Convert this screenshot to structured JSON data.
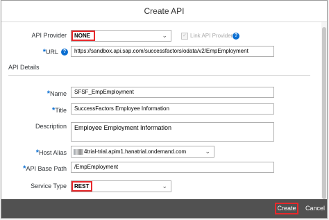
{
  "dialog": {
    "title": "Create API"
  },
  "fields": {
    "api_provider": {
      "label": "API Provider",
      "value": "NONE"
    },
    "link_api_provider": {
      "label": "Link API Provider",
      "checked": true,
      "disabled": true
    },
    "url": {
      "label": "URL",
      "value": "https://sandbox.api.sap.com/successfactors/odata/v2/EmpEmployment"
    },
    "section_title": "API Details",
    "name": {
      "label": "Name",
      "value": "SFSF_EmpEmployment"
    },
    "title": {
      "label": "Title",
      "value": "SuccessFactors Employee Information"
    },
    "description": {
      "label": "Description",
      "value": "Employee Employment Information"
    },
    "host_alias": {
      "label": "Host Alias",
      "value": "4trial-trial.apim1.hanatrial.ondemand.com"
    },
    "api_base_path": {
      "label": "API Base Path",
      "value": "/EmpEmployment"
    },
    "service_type": {
      "label": "Service Type",
      "value": "REST"
    }
  },
  "footer": {
    "create_label": "Create",
    "cancel_label": "Cancel"
  },
  "colors": {
    "accent": "#0a6ed1",
    "highlight": "#e8282b",
    "footer": "#515151"
  },
  "icons": {
    "help": "help-icon",
    "dropdown": "chevron-down-icon",
    "checkbox": "checkbox-icon"
  }
}
